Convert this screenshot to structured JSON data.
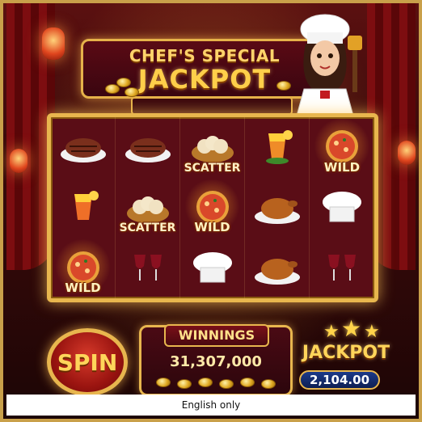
{
  "title": {
    "line1": "CHEF'S SPECIAL",
    "line2": "JACKPOT"
  },
  "reels": [
    [
      {
        "symbol": "steak",
        "label": ""
      },
      {
        "symbol": "cocktail",
        "label": ""
      },
      {
        "symbol": "pizza",
        "label": "WILD",
        "fire": true
      }
    ],
    [
      {
        "symbol": "steak",
        "label": ""
      },
      {
        "symbol": "dumplings",
        "label": "SCATTER"
      },
      {
        "symbol": "wine",
        "label": ""
      }
    ],
    [
      {
        "symbol": "dumplings",
        "label": "SCATTER"
      },
      {
        "symbol": "pizza",
        "label": "WILD",
        "fire": true
      },
      {
        "symbol": "chef-hat",
        "label": ""
      }
    ],
    [
      {
        "symbol": "cocktail",
        "label": ""
      },
      {
        "symbol": "roast-chicken",
        "label": ""
      },
      {
        "symbol": "roast-chicken",
        "label": ""
      }
    ],
    [
      {
        "symbol": "pizza",
        "label": "WILD",
        "fire": true
      },
      {
        "symbol": "chef-hat",
        "label": ""
      },
      {
        "symbol": "wine",
        "label": ""
      }
    ]
  ],
  "controls": {
    "spin_label": "SPIN",
    "winnings_label": "WINNINGS",
    "winnings_value": "31,307,000",
    "jackpot_label": "JACKPOT",
    "jackpot_value": "2,104.00"
  },
  "footer": {
    "text": "English only"
  },
  "colors": {
    "gold": "#e8b64e",
    "maroon": "#5a0d16",
    "jackpot_blue": "#1c3a8a"
  }
}
